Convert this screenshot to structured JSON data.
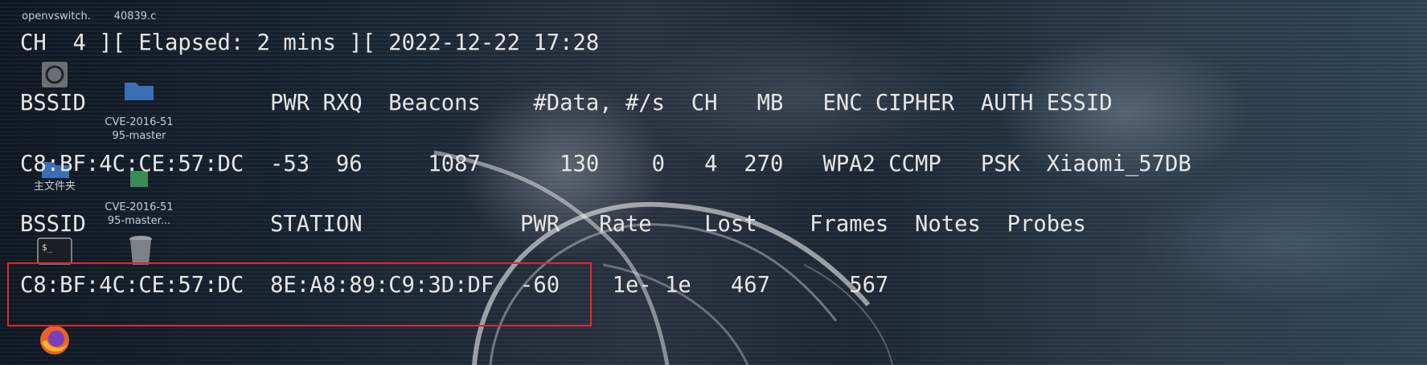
{
  "desktop": {
    "icons": [
      {
        "label": "openvswitch.",
        "icon": "file-icon"
      },
      {
        "label": "40839.c",
        "icon": "file-icon"
      },
      {
        "label": "",
        "icon": "disc-icon"
      },
      {
        "label": "CVE-2016-51\n95-master",
        "icon": "folder-icon"
      },
      {
        "label": "主文件夹",
        "icon": "home-folder-icon"
      },
      {
        "label": "CVE-2016-51\n95-master...",
        "icon": "archive-icon"
      },
      {
        "label": "",
        "icon": "terminal-icon"
      },
      {
        "label": "",
        "icon": "trash-icon"
      },
      {
        "label": "",
        "icon": "firefox-icon"
      }
    ]
  },
  "terminal": {
    "status_line": "CH  4 ][ Elapsed: 2 mins ][ 2022-12-22 17:28",
    "ap_header": "BSSID              PWR RXQ  Beacons    #Data, #/s  CH   MB   ENC CIPHER  AUTH ESSID",
    "ap_row": "C8:BF:4C:CE:57:DC  -53  96     1087      130    0   4  270   WPA2 CCMP   PSK  Xiaomi_57DB",
    "station_header": "BSSID              STATION            PWR   Rate    Lost    Frames  Notes  Probes",
    "station_row": "C8:BF:4C:CE:57:DC  8E:A8:89:C9:3D:DF  -60    1e- 1e   467      567"
  },
  "colors": {
    "highlight": "#e0262c",
    "terminal_text": "#e6e6e6"
  }
}
